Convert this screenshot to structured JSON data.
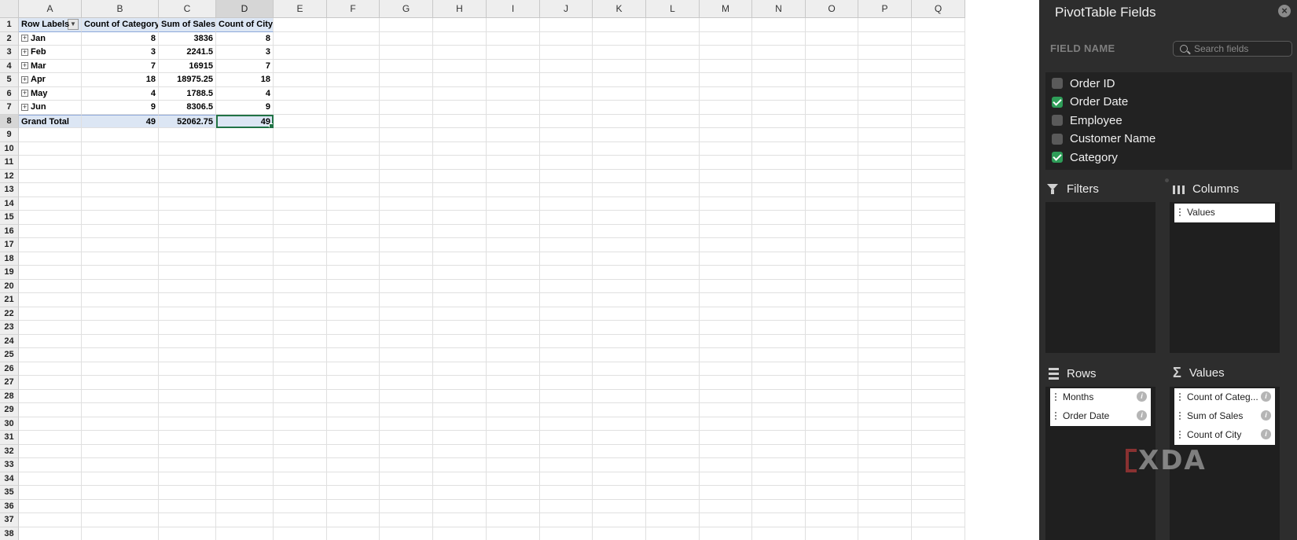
{
  "sheet": {
    "columns": [
      "A",
      "B",
      "C",
      "D",
      "E",
      "F",
      "G",
      "H",
      "I",
      "J",
      "K",
      "L",
      "M",
      "N",
      "O",
      "P",
      "Q"
    ],
    "selected_column": "D",
    "selected_row": 8,
    "row_count": 38,
    "pivot": {
      "headers": [
        "Row Labels",
        "Count of Category",
        "Sum of Sales",
        "Count of City"
      ],
      "rows": [
        {
          "label": "Jan",
          "count_category": "8",
          "sum_sales": "3836",
          "count_city": "8"
        },
        {
          "label": "Feb",
          "count_category": "3",
          "sum_sales": "2241.5",
          "count_city": "3"
        },
        {
          "label": "Mar",
          "count_category": "7",
          "sum_sales": "16915",
          "count_city": "7"
        },
        {
          "label": "Apr",
          "count_category": "18",
          "sum_sales": "18975.25",
          "count_city": "18"
        },
        {
          "label": "May",
          "count_category": "4",
          "sum_sales": "1788.5",
          "count_city": "4"
        },
        {
          "label": "Jun",
          "count_category": "9",
          "sum_sales": "8306.5",
          "count_city": "9"
        }
      ],
      "total": {
        "label": "Grand Total",
        "count_category": "49",
        "sum_sales": "52062.75",
        "count_city": "49"
      },
      "expander_symbol": "+",
      "dropdown_symbol": "▼"
    }
  },
  "panel": {
    "title": "PivotTable Fields",
    "close_symbol": "×",
    "field_name_header": "FIELD NAME",
    "search_placeholder": "Search fields",
    "fields": [
      {
        "label": "Order ID",
        "checked": false
      },
      {
        "label": "Order Date",
        "checked": true
      },
      {
        "label": "Employee",
        "checked": false
      },
      {
        "label": "Customer Name",
        "checked": false
      },
      {
        "label": "Category",
        "checked": true
      }
    ],
    "filters_label": "Filters",
    "columns_label": "Columns",
    "rows_label": "Rows",
    "values_label": "Values",
    "sigma_symbol": "Σ",
    "columns_items": [
      "Values"
    ],
    "rows_items": [
      "Months",
      "Order Date"
    ],
    "values_items": [
      "Count of Categ...",
      "Sum of Sales",
      "Count of City"
    ],
    "info_symbol": "i"
  },
  "watermark": "XDA"
}
